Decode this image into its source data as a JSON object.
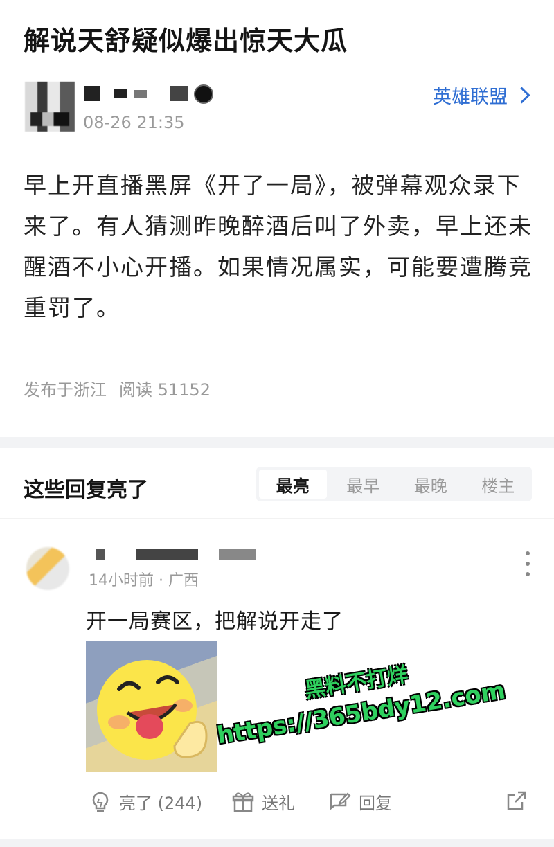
{
  "post": {
    "title": "解说天舒疑似爆出惊天大瓜",
    "time": "08-26 21:35",
    "topic": "英雄联盟",
    "body": "早上开直播黑屏《开了一局》，被弹幕观众录下来了。有人猜测昨晚醉酒后叫了外卖，早上还未醒酒不小心开播。如果情况属实，可能要遭腾竞重罚了。",
    "location": "发布于浙江",
    "reads": "阅读 51152"
  },
  "comments_section": {
    "title": "这些回复亮了",
    "tabs": [
      "最亮",
      "最早",
      "最晚",
      "楼主"
    ],
    "active_tab": "最亮"
  },
  "comment": {
    "meta": "14小时前 · 广西",
    "text": "开一局赛区，把解说开走了",
    "like_label": "亮了 (244)",
    "gift_label": "送礼",
    "reply_label": "回复"
  },
  "watermark": {
    "line1": "黑料不打烊",
    "line2": "https://365bdy12.com"
  },
  "colors": {
    "link": "#2f6ed3",
    "muted": "#999999",
    "watermark": "#2fd05e"
  },
  "icons": [
    "chevron-right-icon",
    "more-vertical-icon",
    "lightbulb-icon",
    "gift-icon",
    "reply-icon",
    "share-icon"
  ]
}
